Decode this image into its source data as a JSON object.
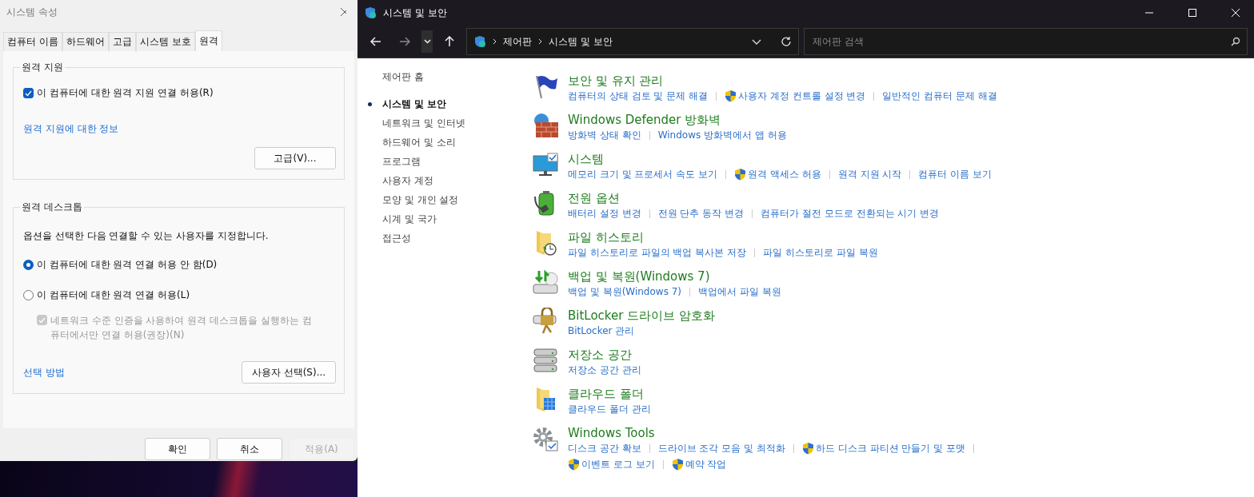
{
  "dialog": {
    "title": "시스템 속성",
    "tabs": [
      {
        "label": "컴퓨터 이름",
        "selected": false
      },
      {
        "label": "하드웨어",
        "selected": false
      },
      {
        "label": "고급",
        "selected": false
      },
      {
        "label": "시스템 보호",
        "selected": false
      },
      {
        "label": "원격",
        "selected": true
      }
    ],
    "remote_assistance": {
      "legend": "원격 지원",
      "checkbox": {
        "label": "이 컴퓨터에 대한 원격 지원 연결 허용(R)",
        "checked": true
      },
      "link": "원격 지원에 대한 정보",
      "button": "고급(V)..."
    },
    "remote_desktop": {
      "legend": "원격 데스크톱",
      "description": "옵션을 선택한 다음 연결할 수 있는 사용자를 지정합니다.",
      "options": [
        {
          "label": "이 컴퓨터에 대한 원격 연결 허용 안 함(D)",
          "selected": true
        },
        {
          "label": "이 컴퓨터에 대한 원격 연결 허용(L)",
          "selected": false
        }
      ],
      "nla": {
        "label": "네트워크 수준 인증을 사용하여 원격 데스크톱을 실행하는 컴퓨터에서만 연결 허용(권장)(N)",
        "checked": true,
        "disabled": true
      },
      "link": "선택 방법",
      "button": "사용자 선택(S)..."
    },
    "buttons": [
      {
        "label": "확인",
        "disabled": false
      },
      {
        "label": "취소",
        "disabled": false
      },
      {
        "label": "적용(A)",
        "disabled": true
      }
    ]
  },
  "explorer": {
    "title": "시스템 및 보안",
    "breadcrumb": [
      "제어판",
      "시스템 및 보안"
    ],
    "search": {
      "placeholder": "제어판 검색"
    },
    "sidebar": [
      {
        "label": "제어판 홈",
        "selected": false
      },
      {
        "label": "시스템 및 보안",
        "selected": true
      },
      {
        "label": "네트워크 및 인터넷",
        "selected": false
      },
      {
        "label": "하드웨어 및 소리",
        "selected": false
      },
      {
        "label": "프로그램",
        "selected": false
      },
      {
        "label": "사용자 계정",
        "selected": false
      },
      {
        "label": "모양 및 개인 설정",
        "selected": false
      },
      {
        "label": "시계 및 국가",
        "selected": false
      },
      {
        "label": "접근성",
        "selected": false
      }
    ],
    "categories": [
      {
        "kind": "flag",
        "title": "보안 및 유지 관리",
        "links": [
          {
            "label": "컴퓨터의 상태 검토 및 문제 해결",
            "shield": false
          },
          {
            "label": "사용자 계정 컨트롤 설정 변경",
            "shield": true
          },
          {
            "label": "일반적인 컴퓨터 문제 해결",
            "shield": false
          }
        ]
      },
      {
        "kind": "firewall",
        "title": "Windows Defender 방화벽",
        "links": [
          {
            "label": "방화벽 상태 확인",
            "shield": false
          },
          {
            "label": "Windows 방화벽에서 앱 허용",
            "shield": false
          }
        ]
      },
      {
        "kind": "monitor",
        "title": "시스템",
        "links": [
          {
            "label": "메모리 크기 및 프로세서 속도 보기",
            "shield": false
          },
          {
            "label": "원격 액세스 허용",
            "shield": true
          },
          {
            "label": "원격 지원 시작",
            "shield": false
          },
          {
            "label": "컴퓨터 이름 보기",
            "shield": false
          }
        ]
      },
      {
        "kind": "battery",
        "title": "전원 옵션",
        "links": [
          {
            "label": "배터리 설정 변경",
            "shield": false
          },
          {
            "label": "전원 단추 동작 변경",
            "shield": false
          },
          {
            "label": "컴퓨터가 절전 모드로 전환되는 시기 변경",
            "shield": false
          }
        ]
      },
      {
        "kind": "history",
        "title": "파일 히스토리",
        "links": [
          {
            "label": "파일 히스토리로 파일의 백업 복사본 저장",
            "shield": false
          },
          {
            "label": "파일 히스토리로 파일 복원",
            "shield": false
          }
        ]
      },
      {
        "kind": "backup",
        "title": "백업 및 복원(Windows 7)",
        "links": [
          {
            "label": "백업 및 복원(Windows 7)",
            "shield": false
          },
          {
            "label": "백업에서 파일 복원",
            "shield": false
          }
        ]
      },
      {
        "kind": "lock",
        "title": "BitLocker 드라이브 암호화",
        "links": [
          {
            "label": "BitLocker 관리",
            "shield": false
          }
        ]
      },
      {
        "kind": "drives",
        "title": "저장소 공간",
        "links": [
          {
            "label": "저장소 공간 관리",
            "shield": false
          }
        ]
      },
      {
        "kind": "cloud",
        "title": "클라우드 폴더",
        "links": [
          {
            "label": "클라우드 폴더 관리",
            "shield": false
          }
        ]
      },
      {
        "kind": "gear",
        "title": "Windows Tools",
        "links": [
          {
            "label": "디스크 공간 확보",
            "shield": false
          },
          {
            "label": "드라이브 조각 모음 및 최적화",
            "shield": false
          },
          {
            "label": "하드 디스크 파티션 만들기 및 포맷",
            "shield": true
          },
          {
            "label": "이벤트 로그 보기",
            "shield": true
          },
          {
            "label": "예약 작업",
            "shield": true
          }
        ]
      }
    ]
  }
}
